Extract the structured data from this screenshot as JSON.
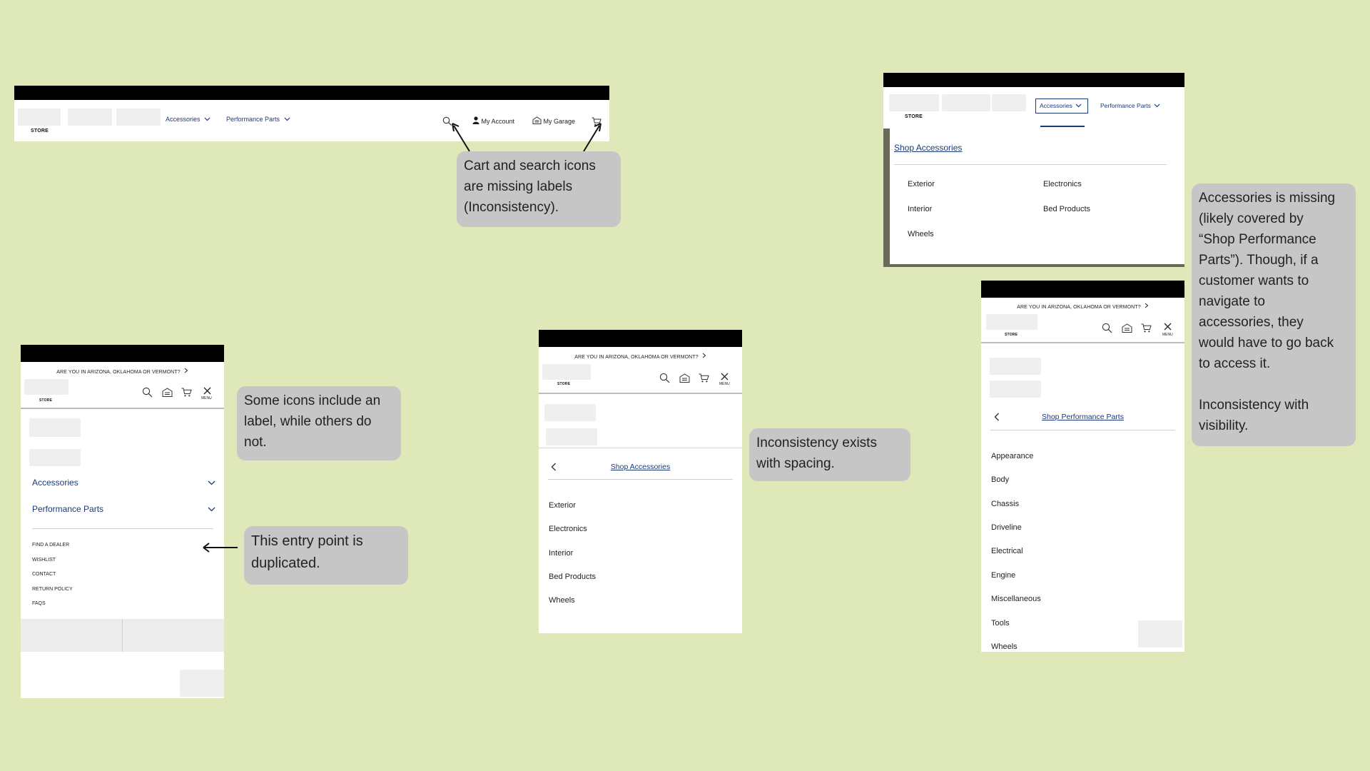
{
  "desktop_nav": {
    "store_label": "STORE",
    "accessories_label": "Accessories",
    "performance_label": "Performance Parts",
    "account_label": "My Account",
    "garage_label": "My Garage"
  },
  "callouts": {
    "cart_search": "Cart and search icons\nare missing labels\n(Inconsistency).",
    "icons_label": "Some icons include an\nlabel, while others do\nnot.",
    "entry_point": "This entry point is\nduplicated.",
    "spacing": "Inconsistency exists\nwith spacing.",
    "visibility": "Accessories is missing\n(likely covered by\n“Shop Performance\nParts”). Though, if a\ncustomer wants to\nnavigate to\naccessories, they\nwould have to go back\nto access it.\n\nInconsistency with\nvisibility."
  },
  "dropdown": {
    "store_label": "STORE",
    "accessories_label": "Accessories",
    "performance_label": "Performance Parts",
    "shop_link": "Shop Accessories",
    "items": [
      "Exterior",
      "Electronics",
      "Interior",
      "Bed Products",
      "Wheels"
    ]
  },
  "mobile_menu": {
    "banner": "ARE YOU IN ARIZONA, OKLAHOMA OR VERMONT?",
    "store_label": "STORE",
    "menu_label": "MENU",
    "accessories": "Accessories",
    "performance": "Performance Parts",
    "links": [
      "FIND A DEALER",
      "WISHLIST",
      "CONTACT",
      "RETURN POLICY",
      "FAQS"
    ]
  },
  "mobile_accessories": {
    "banner": "ARE YOU IN ARIZONA, OKLAHOMA OR VERMONT?",
    "store_label": "STORE",
    "menu_label": "MENU",
    "shop_link": "Shop Accessories",
    "items": [
      "Exterior",
      "Electronics",
      "Interior",
      "Bed Products",
      "Wheels"
    ]
  },
  "mobile_performance": {
    "banner": "ARE YOU IN ARIZONA, OKLAHOMA OR VERMONT?",
    "store_label": "STORE",
    "menu_label": "MENU",
    "shop_link": "Shop Performance Parts",
    "items": [
      "Appearance",
      "Body",
      "Chassis",
      "Driveline",
      "Electrical",
      "Engine",
      "Miscellaneous",
      "Tools",
      "Wheels"
    ]
  }
}
